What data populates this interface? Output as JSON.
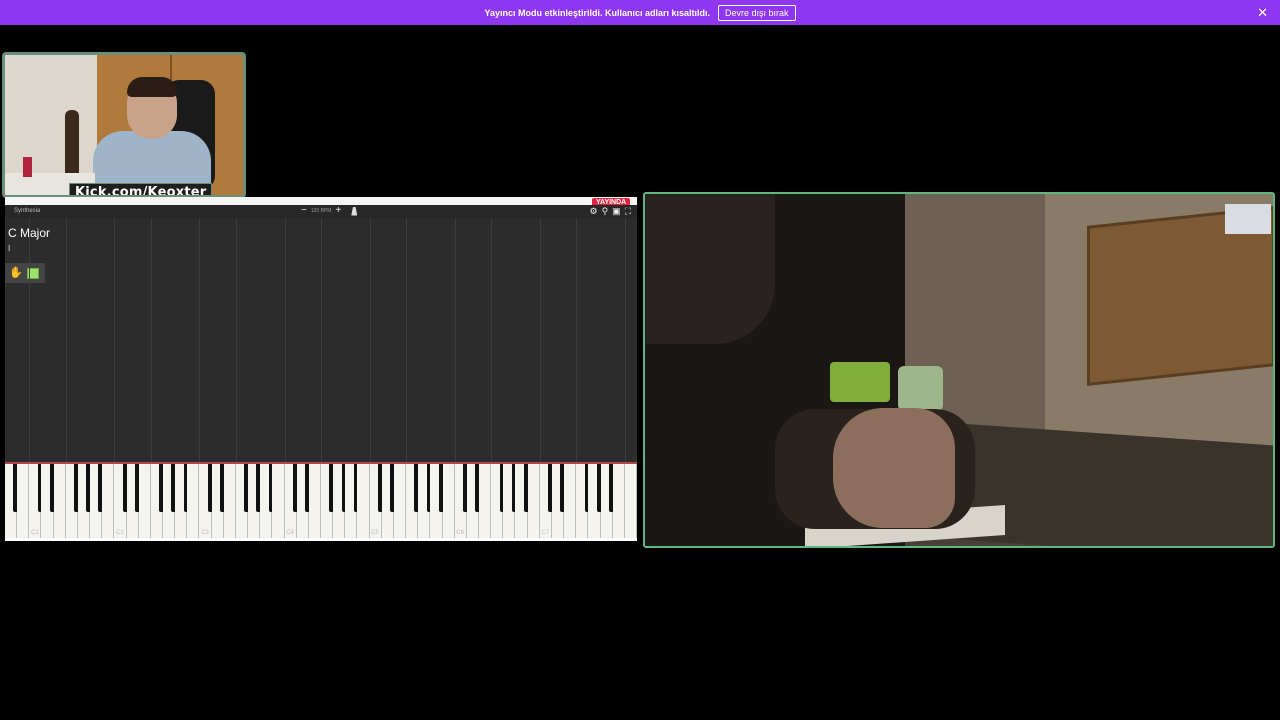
{
  "banner": {
    "message": "Yayıncı Modu etkinleştirildi. Kullanıcı adları kısaltıldı.",
    "disable_label": "Devre dışı bırak",
    "close_glyph": "✕",
    "color": "#8f36f0"
  },
  "facecam": {
    "channel_label": "Kick.com/Keoxter"
  },
  "synthesia": {
    "app_name": "Synthesia",
    "tempo_minus": "−",
    "tempo_value": "120 BPM",
    "tempo_plus": "+",
    "live_badge": "YAYINDA",
    "song_title": "C Major",
    "song_subtitle": "I",
    "tool_icons": [
      "settings-icon",
      "search-icon",
      "image-icon",
      "fullscreen-icon"
    ],
    "octave_labels": [
      "C1",
      "C2",
      "C3",
      "C4",
      "C5",
      "C6",
      "C7"
    ]
  },
  "handcam": {
    "border_color": "#5db87f"
  }
}
